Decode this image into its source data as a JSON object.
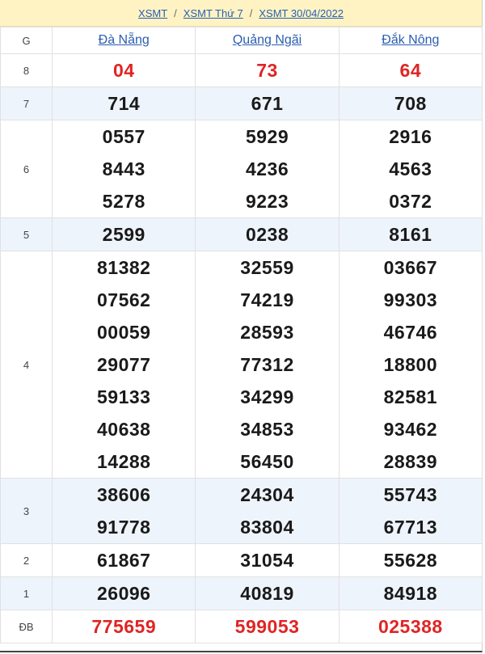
{
  "breadcrumb": {
    "items": [
      "XSMT",
      "XSMT Thứ 7",
      "XSMT 30/04/2022"
    ],
    "separator": "/"
  },
  "table": {
    "label_header": "G",
    "provinces": [
      "Đà Nẵng",
      "Quảng Ngãi",
      "Đắk Nông"
    ],
    "prizes": [
      {
        "label": "8",
        "values": [
          [
            "04"
          ],
          [
            "73"
          ],
          [
            "64"
          ]
        ]
      },
      {
        "label": "7",
        "values": [
          [
            "714"
          ],
          [
            "671"
          ],
          [
            "708"
          ]
        ]
      },
      {
        "label": "6",
        "values": [
          [
            "0557",
            "8443",
            "5278"
          ],
          [
            "5929",
            "4236",
            "9223"
          ],
          [
            "2916",
            "4563",
            "0372"
          ]
        ]
      },
      {
        "label": "5",
        "values": [
          [
            "2599"
          ],
          [
            "0238"
          ],
          [
            "8161"
          ]
        ]
      },
      {
        "label": "4",
        "values": [
          [
            "81382",
            "07562",
            "00059",
            "29077",
            "59133",
            "40638",
            "14288"
          ],
          [
            "32559",
            "74219",
            "28593",
            "77312",
            "34299",
            "34853",
            "56450"
          ],
          [
            "03667",
            "99303",
            "46746",
            "18800",
            "82581",
            "93462",
            "28839"
          ]
        ]
      },
      {
        "label": "3",
        "values": [
          [
            "38606",
            "91778"
          ],
          [
            "24304",
            "83804"
          ],
          [
            "55743",
            "67713"
          ]
        ]
      },
      {
        "label": "2",
        "values": [
          [
            "61867"
          ],
          [
            "31054"
          ],
          [
            "55628"
          ]
        ]
      },
      {
        "label": "1",
        "values": [
          [
            "26096"
          ],
          [
            "40819"
          ],
          [
            "84918"
          ]
        ]
      },
      {
        "label": "ĐB",
        "values": [
          [
            "775659"
          ],
          [
            "599053"
          ],
          [
            "025388"
          ]
        ]
      }
    ]
  },
  "colors": {
    "breadcrumb_bg": "#fff3c3",
    "alt_row_bg": "#eef4fb",
    "link": "#2a5db0",
    "highlight_red": "#e02424",
    "number": "#1a1a1a"
  }
}
